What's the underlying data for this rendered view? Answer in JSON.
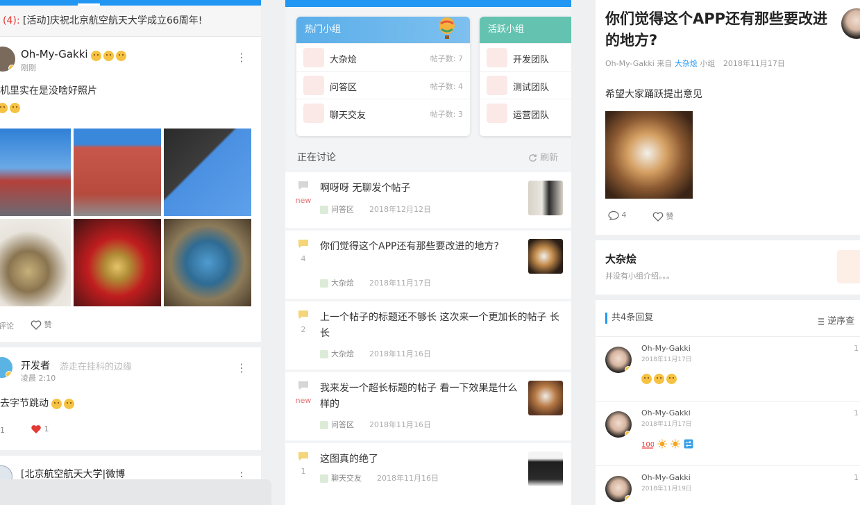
{
  "feed": {
    "announcement_count": "(4):",
    "announcement_text": "[活动]庆祝北京航空航天大学成立66周年!",
    "posts": [
      {
        "author": "Oh-My-Gakki",
        "author_tag": "刚刚",
        "text": "机里实在是没啥好照片",
        "comment_label": "评论",
        "like_label": "赞"
      },
      {
        "author": "开发者",
        "author_signature": "游走在挂科的边缘",
        "time": "凌晨 2:10",
        "text": "去字节跳动",
        "comment_count": "1",
        "like_count": "1"
      },
      {
        "author": "[北京航空航天大学|微博"
      }
    ]
  },
  "groups": {
    "hot": {
      "title": "热门小组",
      "items": [
        {
          "name": "大杂烩",
          "count": "帖子数: 7"
        },
        {
          "name": "问答区",
          "count": "帖子数: 4"
        },
        {
          "name": "聊天交友",
          "count": "帖子数: 3"
        }
      ]
    },
    "active": {
      "title": "活跃小组",
      "items": [
        {
          "name": "开发团队"
        },
        {
          "name": "测试团队"
        },
        {
          "name": "运营团队"
        }
      ]
    },
    "discussion_title": "正在讨论",
    "refresh_label": "刷新",
    "topics": [
      {
        "title": "啊呀呀   无聊发个帖子",
        "badge": "new",
        "group": "问答区",
        "date": "2018年12月12日"
      },
      {
        "title": "你们觉得这个APP还有那些要改进的地方?",
        "badge": "4",
        "group": "大杂烩",
        "date": "2018年11月17日"
      },
      {
        "title": "上一个帖子的标题还不够长  这次来一个更加长的帖子 长 长",
        "badge": "2",
        "group": "大杂烩",
        "date": "2018年11月16日"
      },
      {
        "title": "我来发一个超长标题的帖子  看一下效果是什么样的",
        "badge": "new",
        "group": "问答区",
        "date": "2018年11月16日"
      },
      {
        "title": "这图真的绝了",
        "badge": "1",
        "group": "聊天交友",
        "date": "2018年11月16日"
      }
    ]
  },
  "detail": {
    "title": "你们觉得这个APP还有那些要改进的地方?",
    "author": "Oh-My-Gakki",
    "from_label": "来自",
    "group": "大杂烩",
    "group_suffix": "小组",
    "date": "2018年11月17日",
    "body": "希望大家踊跃提出意见",
    "comment_count": "4",
    "like_label": "赞",
    "group_card": {
      "name": "大杂烩",
      "desc": "并没有小组介绍。。。"
    },
    "replies_header": "共4条回复",
    "sort_label": "逆序查",
    "replies": [
      {
        "author": "Oh-My-Gakki",
        "time": "2018年11月17日",
        "floor": "1"
      },
      {
        "author": "Oh-My-Gakki",
        "time": "2018年11月17日",
        "floor": "1"
      },
      {
        "author": "Oh-My-Gakki",
        "time": "2018年11月19日",
        "floor": "1"
      }
    ]
  },
  "colors": {
    "accent": "#2196f3",
    "hot_header": "#5aaee9",
    "active_header": "#63c3b0",
    "new_badge": "#e57373",
    "heart": "#e53935"
  }
}
